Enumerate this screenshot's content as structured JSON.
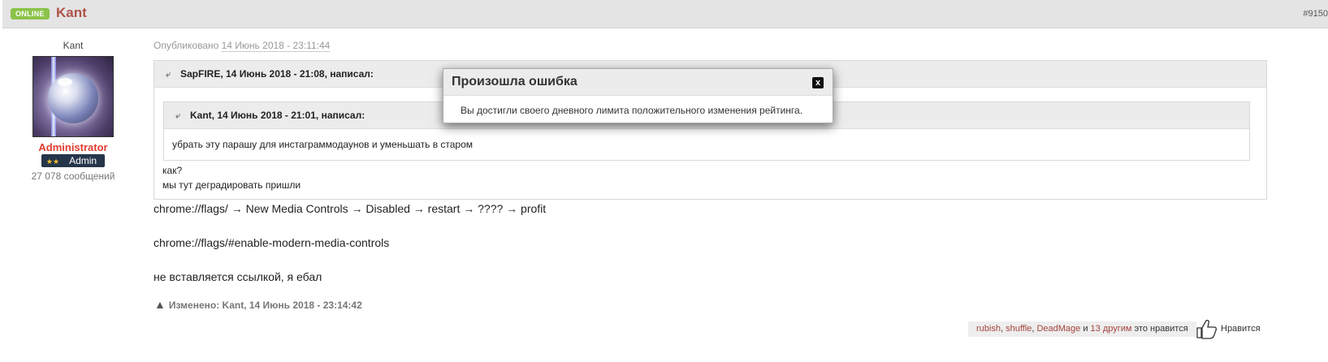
{
  "header": {
    "online_badge": "ONLINE",
    "author_name": "Kant",
    "post_number": "#9150"
  },
  "author": {
    "nickname": "Kant",
    "role": "Administrator",
    "rank_stars": "★★",
    "rank_label": "Admin",
    "post_count": "27 078 сообщений"
  },
  "post": {
    "posted_prefix": "Опубликовано",
    "posted_date": "14 Июнь 2018 - 23:11:44",
    "quote_outer": {
      "citation": "SapFIRE, 14 Июнь 2018 - 21:08, написал:",
      "lines": [
        "как?",
        "мы тут деградировать пришли"
      ]
    },
    "quote_inner": {
      "citation": "Kant, 14 Июнь 2018 - 21:01, написал:",
      "text": "убрать эту парашу для инстаграммодаунов и уменьшать в старом"
    },
    "body": [
      "chrome://flags/ → New Media Controls → Disabled → restart → ???? → profit",
      "chrome://flags/#enable-modern-media-controls",
      "не вставляется ссылкой, я ебал"
    ],
    "edited": "Изменено: Kant, 14 Июнь 2018 - 23:14:42"
  },
  "likes": {
    "users": [
      "rubish",
      "shuffle",
      "DeadMage"
    ],
    "separator": ",",
    "and": "и",
    "others": "13 другим",
    "suffix": "это нравится",
    "like_button": "Нравится"
  },
  "modal": {
    "title": "Произошла ошибка",
    "close": "x",
    "message": "Вы достигли своего дневного лимита положительного изменения рейтинга."
  },
  "colors": {
    "online": "#8bc34a",
    "author": "#b0524a",
    "admin": "#e03b2f",
    "rank_bg": "#26364a"
  }
}
